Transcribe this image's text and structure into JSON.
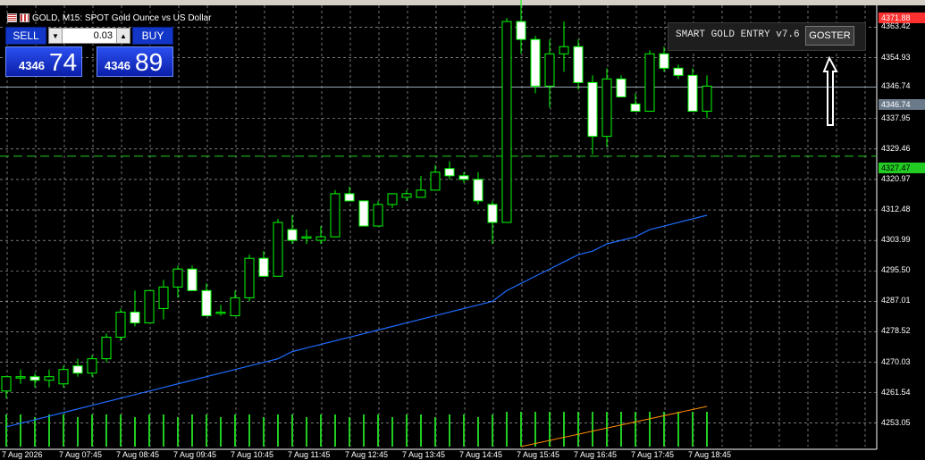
{
  "window": {
    "title": "GOLD, M15:  SPOT Gold Ounce vs US Dollar"
  },
  "trade_panel": {
    "sell_label": "SELL",
    "buy_label": "BUY",
    "lot_value": "0.03",
    "sell_price_small": "4346",
    "sell_price_big": "74",
    "buy_price_small": "4346",
    "buy_price_big": "89"
  },
  "info_panel": {
    "title": "SMART GOLD ENTRY v7.6",
    "button_label": "GOSTER"
  },
  "price_axis": {
    "ticks": [
      "4363.42",
      "4354.93",
      "4346.74",
      "4337.95",
      "4329.46",
      "4320.97",
      "4312.48",
      "4303.99",
      "4295.50",
      "4287.01",
      "4278.52",
      "4270.03",
      "4261.54",
      "4253.05"
    ],
    "tags": {
      "top_red": "4371.88",
      "current": "4346.74",
      "green_line": "4327.47"
    }
  },
  "time_axis": {
    "labels": [
      "7 Aug 2026",
      "7 Aug 07:45",
      "7 Aug 08:45",
      "7 Aug 09:45",
      "7 Aug 10:45",
      "7 Aug 11:45",
      "7 Aug 12:45",
      "7 Aug 13:45",
      "7 Aug 14:45",
      "7 Aug 15:45",
      "7 Aug 16:45",
      "7 Aug 17:45",
      "7 Aug 18:45"
    ]
  },
  "colors": {
    "bull_fill": "#000000",
    "bull_stroke": "#00ff00",
    "bear_fill": "#ffffff",
    "grid": "#c0c0c0",
    "ma_line": "#1e6cff",
    "volume": "#22cc22",
    "level_red": "#ff3030",
    "level_green": "#22cc22"
  },
  "chart_data": {
    "type": "candlestick",
    "symbol": "GOLD",
    "timeframe": "M15",
    "ylim": [
      4249,
      4372
    ],
    "candles": [
      {
        "o": 4262,
        "h": 4266,
        "l": 4260,
        "c": 4266
      },
      {
        "o": 4266,
        "h": 4268,
        "l": 4264,
        "c": 4266
      },
      {
        "o": 4266,
        "h": 4267,
        "l": 4263,
        "c": 4265
      },
      {
        "o": 4265,
        "h": 4268,
        "l": 4263,
        "c": 4266
      },
      {
        "o": 4264,
        "h": 4269,
        "l": 4263,
        "c": 4268
      },
      {
        "o": 4269,
        "h": 4271,
        "l": 4266,
        "c": 4267
      },
      {
        "o": 4267,
        "h": 4272,
        "l": 4266,
        "c": 4271
      },
      {
        "o": 4271,
        "h": 4278,
        "l": 4270,
        "c": 4277
      },
      {
        "o": 4277,
        "h": 4285,
        "l": 4276,
        "c": 4284
      },
      {
        "o": 4284,
        "h": 4290,
        "l": 4280,
        "c": 4281
      },
      {
        "o": 4281,
        "h": 4289,
        "l": 4281,
        "c": 4290
      },
      {
        "o": 4285,
        "h": 4293,
        "l": 4282,
        "c": 4291
      },
      {
        "o": 4291,
        "h": 4297,
        "l": 4288,
        "c": 4296
      },
      {
        "o": 4296,
        "h": 4297,
        "l": 4290,
        "c": 4290
      },
      {
        "o": 4290,
        "h": 4292,
        "l": 4284,
        "c": 4283
      },
      {
        "o": 4284,
        "h": 4286,
        "l": 4283,
        "c": 4284
      },
      {
        "o": 4283,
        "h": 4290,
        "l": 4283,
        "c": 4288
      },
      {
        "o": 4288,
        "h": 4300,
        "l": 4287,
        "c": 4299
      },
      {
        "o": 4299,
        "h": 4301,
        "l": 4294,
        "c": 4294
      },
      {
        "o": 4294,
        "h": 4310,
        "l": 4294,
        "c": 4309
      },
      {
        "o": 4307,
        "h": 4311,
        "l": 4303,
        "c": 4304
      },
      {
        "o": 4305,
        "h": 4307,
        "l": 4303,
        "c": 4305
      },
      {
        "o": 4304,
        "h": 4308,
        "l": 4303,
        "c": 4305
      },
      {
        "o": 4305,
        "h": 4318,
        "l": 4305,
        "c": 4317
      },
      {
        "o": 4317,
        "h": 4319,
        "l": 4315,
        "c": 4315
      },
      {
        "o": 4315,
        "h": 4315,
        "l": 4308,
        "c": 4308
      },
      {
        "o": 4308,
        "h": 4315,
        "l": 4308,
        "c": 4314
      },
      {
        "o": 4314,
        "h": 4317,
        "l": 4313,
        "c": 4317
      },
      {
        "o": 4316,
        "h": 4318,
        "l": 4315,
        "c": 4317
      },
      {
        "o": 4316,
        "h": 4322,
        "l": 4316,
        "c": 4318
      },
      {
        "o": 4318,
        "h": 4325,
        "l": 4318,
        "c": 4323
      },
      {
        "o": 4324,
        "h": 4326,
        "l": 4321,
        "c": 4322
      },
      {
        "o": 4322,
        "h": 4323,
        "l": 4320,
        "c": 4321
      },
      {
        "o": 4321,
        "h": 4323,
        "l": 4314,
        "c": 4315
      },
      {
        "o": 4314,
        "h": 4315,
        "l": 4303,
        "c": 4309
      },
      {
        "o": 4309,
        "h": 4366,
        "l": 4309,
        "c": 4365
      },
      {
        "o": 4365,
        "h": 4371,
        "l": 4356,
        "c": 4360
      },
      {
        "o": 4360,
        "h": 4361,
        "l": 4345,
        "c": 4347
      },
      {
        "o": 4347,
        "h": 4360,
        "l": 4341,
        "c": 4356
      },
      {
        "o": 4356,
        "h": 4365,
        "l": 4351,
        "c": 4358
      },
      {
        "o": 4358,
        "h": 4360,
        "l": 4346,
        "c": 4348
      },
      {
        "o": 4348,
        "h": 4350,
        "l": 4328,
        "c": 4333
      },
      {
        "o": 4333,
        "h": 4352,
        "l": 4330,
        "c": 4349
      },
      {
        "o": 4349,
        "h": 4350,
        "l": 4344,
        "c": 4344
      },
      {
        "o": 4342,
        "h": 4345,
        "l": 4340,
        "c": 4340
      },
      {
        "o": 4340,
        "h": 4357,
        "l": 4340,
        "c": 4356
      },
      {
        "o": 4356,
        "h": 4358,
        "l": 4351,
        "c": 4352
      },
      {
        "o": 4352,
        "h": 4353,
        "l": 4349,
        "c": 4350
      },
      {
        "o": 4350,
        "h": 4352,
        "l": 4340,
        "c": 4340
      },
      {
        "o": 4340,
        "h": 4350,
        "l": 4338,
        "c": 4347
      }
    ],
    "ma_series": [
      4252,
      4253,
      4254,
      4255,
      4256,
      4257,
      4258,
      4259,
      4260,
      4261,
      4262,
      4263,
      4264,
      4265,
      4266,
      4267,
      4268,
      4269,
      4270,
      4271,
      4273,
      4274,
      4275,
      4276,
      4277,
      4278,
      4279,
      4280,
      4281,
      4282,
      4283,
      4284,
      4285,
      4286,
      4287,
      4290,
      4292,
      4294,
      4296,
      4298,
      4300,
      4301,
      4303,
      4304,
      4305,
      4307,
      4308,
      4309,
      4310,
      4311
    ],
    "volume_bars": [
      12,
      12,
      11,
      12,
      12,
      11,
      12,
      12,
      12,
      11,
      12,
      12,
      11,
      12,
      12,
      11,
      12,
      12,
      11,
      12,
      12,
      11,
      12,
      12,
      11,
      12,
      12,
      11,
      12,
      12,
      11,
      12,
      12,
      11,
      12,
      13,
      13,
      13,
      13,
      13,
      13,
      13,
      13,
      13,
      13,
      13,
      13,
      13,
      13,
      13
    ],
    "levels": {
      "top_red": 4371.88,
      "current": 4346.74,
      "green_line": 4327.47
    }
  }
}
